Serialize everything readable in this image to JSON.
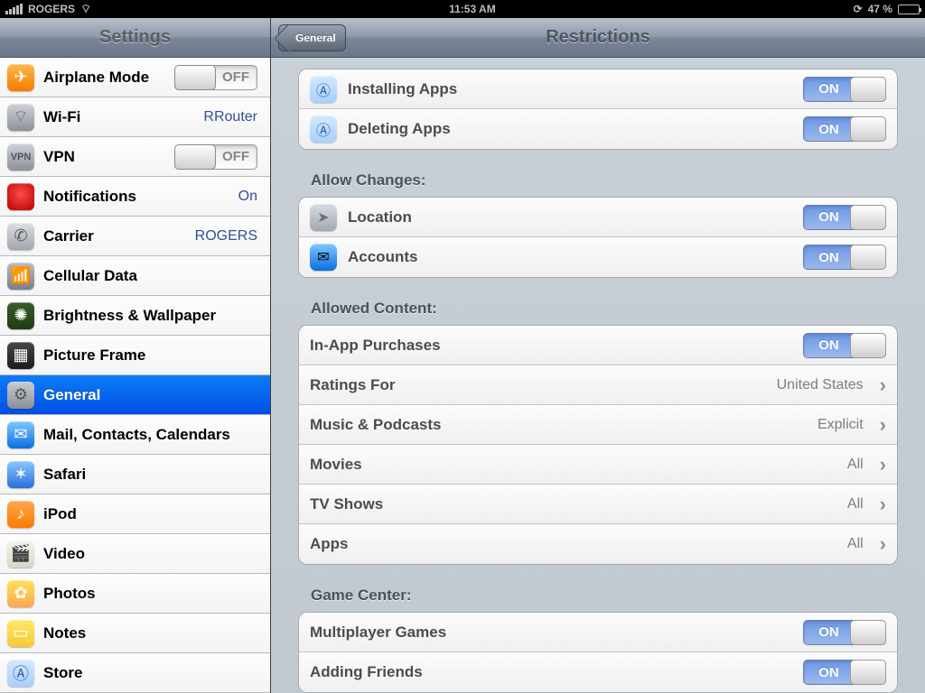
{
  "status": {
    "carrier": "ROGERS",
    "time": "11:53 AM",
    "battery_pct": "47 %"
  },
  "sidebar": {
    "title": "Settings",
    "items": [
      {
        "label": "Airplane Mode",
        "value": "",
        "toggle": "OFF"
      },
      {
        "label": "Wi-Fi",
        "value": "RRouter"
      },
      {
        "label": "VPN",
        "value": "",
        "toggle": "OFF"
      },
      {
        "label": "Notifications",
        "value": "On"
      },
      {
        "label": "Carrier",
        "value": "ROGERS"
      },
      {
        "label": "Cellular Data",
        "value": ""
      },
      {
        "label": "Brightness & Wallpaper",
        "value": ""
      },
      {
        "label": "Picture Frame",
        "value": ""
      },
      {
        "label": "General",
        "value": ""
      },
      {
        "label": "Mail, Contacts, Calendars",
        "value": ""
      },
      {
        "label": "Safari",
        "value": ""
      },
      {
        "label": "iPod",
        "value": ""
      },
      {
        "label": "Video",
        "value": ""
      },
      {
        "label": "Photos",
        "value": ""
      },
      {
        "label": "Notes",
        "value": ""
      },
      {
        "label": "Store",
        "value": ""
      }
    ]
  },
  "detail": {
    "back": "General",
    "title": "Restrictions",
    "on": "ON",
    "group0": [
      {
        "label": "Installing Apps"
      },
      {
        "label": "Deleting Apps"
      }
    ],
    "sec1": "Allow Changes:",
    "group1": [
      {
        "label": "Location"
      },
      {
        "label": "Accounts"
      }
    ],
    "sec2": "Allowed Content:",
    "group2": [
      {
        "label": "In-App Purchases",
        "toggle": true
      },
      {
        "label": "Ratings For",
        "value": "United States"
      },
      {
        "label": "Music & Podcasts",
        "value": "Explicit"
      },
      {
        "label": "Movies",
        "value": "All"
      },
      {
        "label": "TV Shows",
        "value": "All"
      },
      {
        "label": "Apps",
        "value": "All"
      }
    ],
    "sec3": "Game Center:",
    "group3": [
      {
        "label": "Multiplayer Games"
      },
      {
        "label": "Adding Friends"
      }
    ]
  }
}
